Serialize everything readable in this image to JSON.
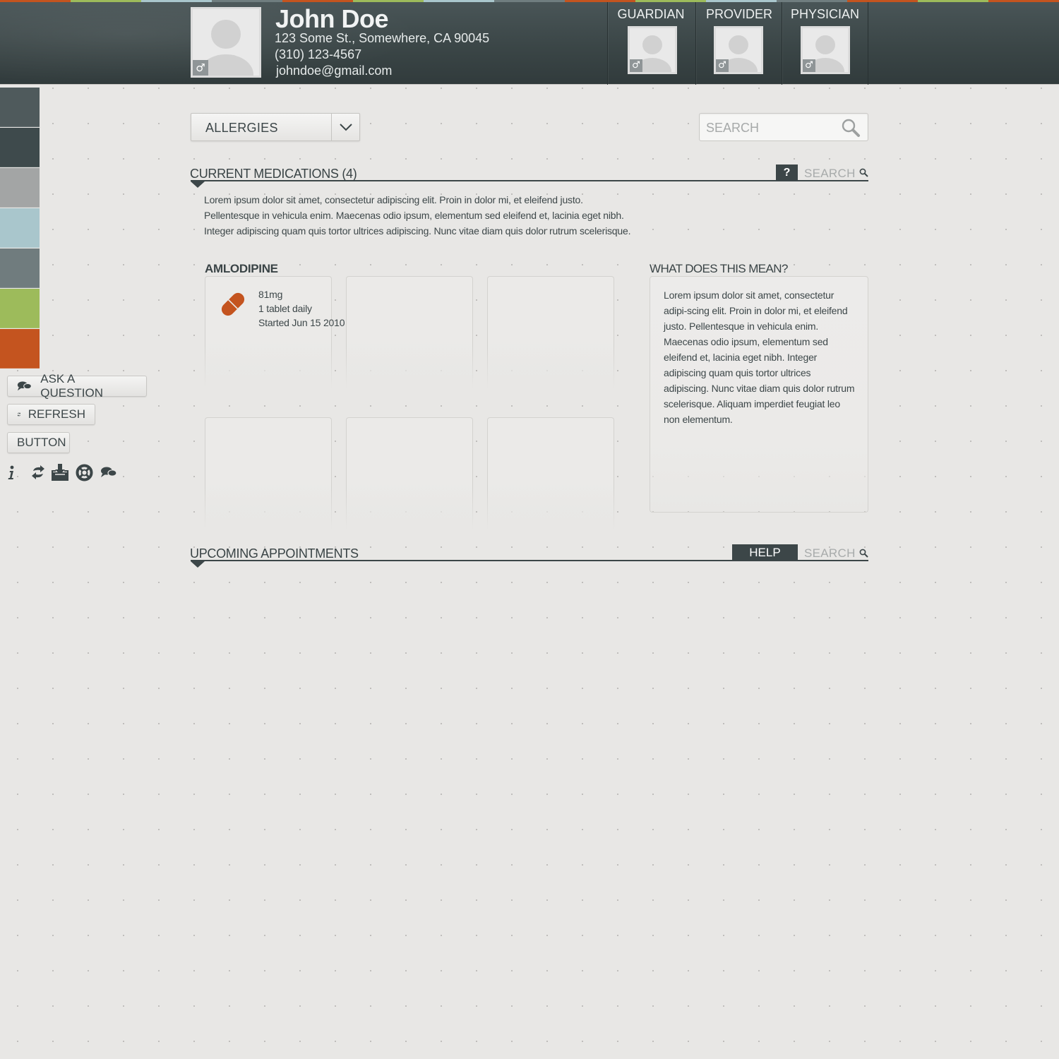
{
  "colors": {
    "header_bg": "#3b4647",
    "accent_orange": "#c4541f",
    "accent_green": "#9dbb5b",
    "dark": "#3c4648"
  },
  "top_stripe": [
    "#c4541f",
    "#9dbb5b",
    "#a9c6cc",
    "#6f7d7f",
    "#c4541f",
    "#9dbb5b",
    "#a9c6cc",
    "#6f7d7f",
    "#c4541f",
    "#9dbb5b",
    "#a9c6cc",
    "#6f7d7f",
    "#c4541f",
    "#9dbb5b",
    "#c4541f"
  ],
  "patient": {
    "name": "John Doe",
    "address": "123 Some St., Somewhere, CA 90045",
    "phone": "(310) 123-4567",
    "email": "johndoe@gmail.com",
    "gender_icon": "male-icon",
    "gender_symbol": "♂"
  },
  "contacts": [
    {
      "label": "GUARDIAN",
      "gender_symbol": "♂"
    },
    {
      "label": "PROVIDER",
      "gender_symbol": "♂"
    },
    {
      "label": "PHYSICIAN",
      "gender_symbol": "♂"
    }
  ],
  "sidebar": {
    "swatches": [
      "#4f5a5c",
      "#3e4a4c",
      "#a3a5a5",
      "#a9c6cc",
      "#707c7e",
      "#9dbb5b",
      "#c4541f"
    ],
    "buttons": {
      "ask": "ASK A QUESTION",
      "refresh": "REFRESH",
      "generic": "BUTTON"
    },
    "tool_icons": [
      "info-icon",
      "transfer-icon",
      "download-icon",
      "lifebuoy-icon",
      "chat-icon"
    ]
  },
  "filter": {
    "selected": "ALLERGIES"
  },
  "search": {
    "placeholder": "SEARCH"
  },
  "medications_section": {
    "title": "CURRENT MEDICATIONS (4)",
    "help_label": "?",
    "search_label": "SEARCH",
    "intro": "Lorem ipsum dolor sit amet, consectetur adipiscing elit. Proin in dolor mi, et eleifend justo. Pellentesque in vehicula enim. Maecenas odio ipsum, elementum sed eleifend et, lacinia eget nibh. Integer adipiscing quam quis tortor ultrices adipiscing. Nunc vitae diam quis dolor rutrum scelerisque.",
    "drug_name": "AMLODIPINE",
    "cards": [
      {
        "dose": "81mg",
        "frequency": "1 tablet daily",
        "started": "Started Jun 15 2010",
        "icon": "pill-icon"
      },
      {},
      {},
      {},
      {},
      {}
    ],
    "explain_title": "WHAT DOES THIS MEAN?",
    "explain_text": "Lorem ipsum dolor sit amet, consectetur adipi-scing elit. Proin in dolor mi, et eleifend justo. Pellentesque in vehicula enim. Maecenas odio ipsum, elementum sed eleifend et, lacinia eget nibh. Integer adipiscing quam quis tortor ultrices adipiscing. Nunc vitae diam quis dolor rutrum scelerisque. Aliquam imperdiet feugiat leo non elementum."
  },
  "appointments_section": {
    "title": "UPCOMING APPOINTMENTS",
    "help_label": "HELP",
    "search_label": "SEARCH"
  }
}
